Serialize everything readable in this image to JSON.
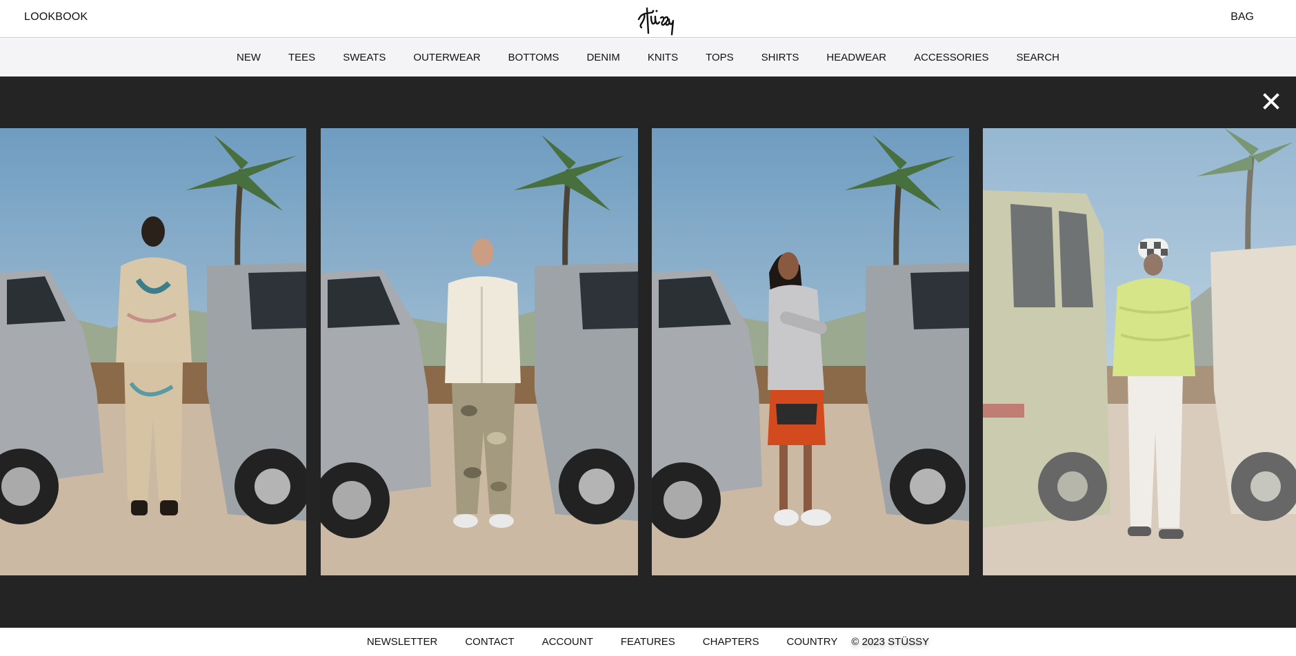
{
  "header": {
    "left_link": "LOOKBOOK",
    "right_link": "BAG",
    "logo_icon": "stussy-script-logo-icon"
  },
  "categories": [
    "NEW",
    "TEES",
    "SWEATS",
    "OUTERWEAR",
    "BOTTOMS",
    "DENIM",
    "KNITS",
    "TOPS",
    "SHIRTS",
    "HEADWEAR",
    "ACCESSORIES",
    "SEARCH"
  ],
  "viewer": {
    "close_icon": "close-icon",
    "background": "#242424",
    "photos": [
      {
        "subject": "model-back-view-printed-jacket",
        "state": "partial"
      },
      {
        "subject": "model-white-jacket-camo-pants",
        "state": "active"
      },
      {
        "subject": "model-grey-hoodie-red-shorts",
        "state": "active"
      },
      {
        "subject": "model-lime-puffer-checker-hat",
        "state": "dimmed"
      }
    ]
  },
  "footer": {
    "links": [
      "NEWSLETTER",
      "CONTACT",
      "ACCOUNT",
      "FEATURES",
      "CHAPTERS",
      "COUNTRY"
    ],
    "copyright": "© 2023 STÜSSY"
  }
}
